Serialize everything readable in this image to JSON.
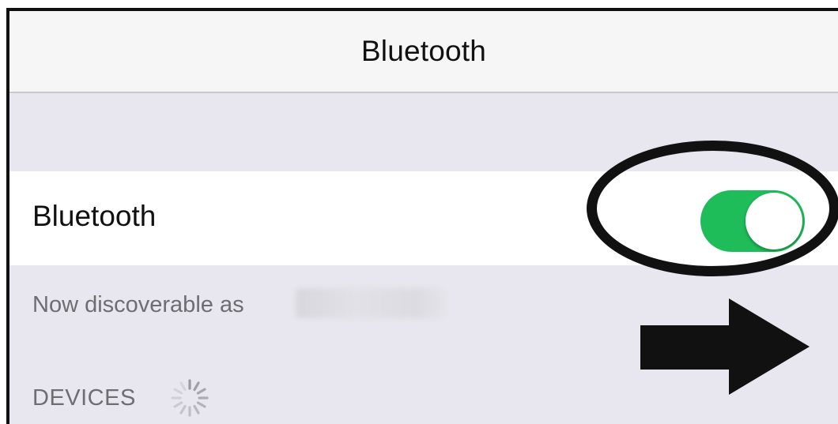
{
  "nav": {
    "title": "Bluetooth"
  },
  "bluetooth_row": {
    "label": "Bluetooth",
    "toggle_state": "on",
    "toggle_color": "#1ebd5a"
  },
  "discoverable": {
    "prefix": "Now discoverable as"
  },
  "devices": {
    "header": "DEVICES",
    "loading_icon": "spinner-icon"
  },
  "annotations": {
    "highlight": "oval-highlight",
    "pointer": "right-arrow-icon"
  }
}
